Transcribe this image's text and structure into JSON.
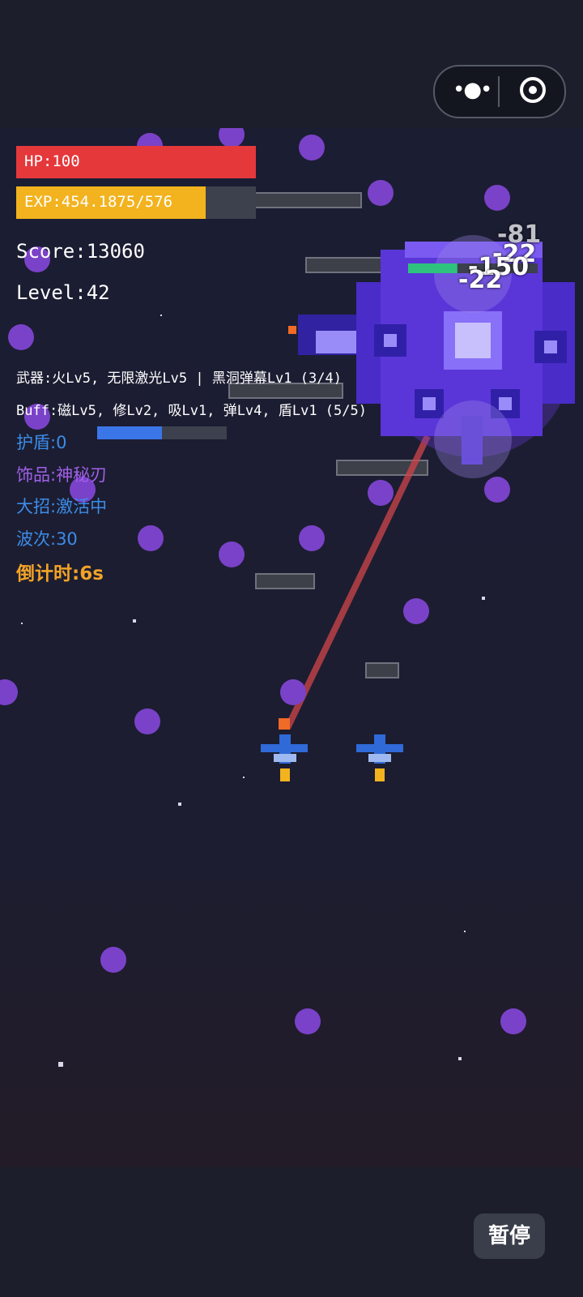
{
  "hud": {
    "hp_label": "HP:100",
    "hp_fraction": 1.0,
    "exp_label": "EXP:454.1875/576",
    "exp_fraction": 0.789,
    "score": "Score:13060",
    "level": "Level:42",
    "weapons": "武器:火Lv5, 无限激光Lv5 | 黑洞弹幕Lv1 (3/4)",
    "buffs": "Buff:磁Lv5, 修Lv2, 吸Lv1, 弹Lv4, 盾Lv1 (5/5)",
    "shield": "护盾:0",
    "shield_fraction": 0.5,
    "accessory": "饰品:神秘刃",
    "ultimate": "大招:激活中",
    "wave": "波次:30",
    "countdown": "倒计时:6s"
  },
  "damage_numbers": [
    "-81",
    "-22",
    "-150",
    "-22"
  ],
  "boss": {
    "hp_fraction": 0.38
  },
  "controls": {
    "pause_label": "暂停"
  },
  "colors": {
    "hp": "#e5383b",
    "exp": "#f2b31f",
    "shield": "#3b76e8",
    "accessory_text": "#a060e8",
    "countdown_text": "#f2a326",
    "laser": "#d0454a",
    "boss": "#6a3ad8"
  },
  "icons": [
    "more-dots-icon",
    "target-icon",
    "boss-ship",
    "player-ship",
    "wingman-ship",
    "purple-orb-enemy"
  ]
}
